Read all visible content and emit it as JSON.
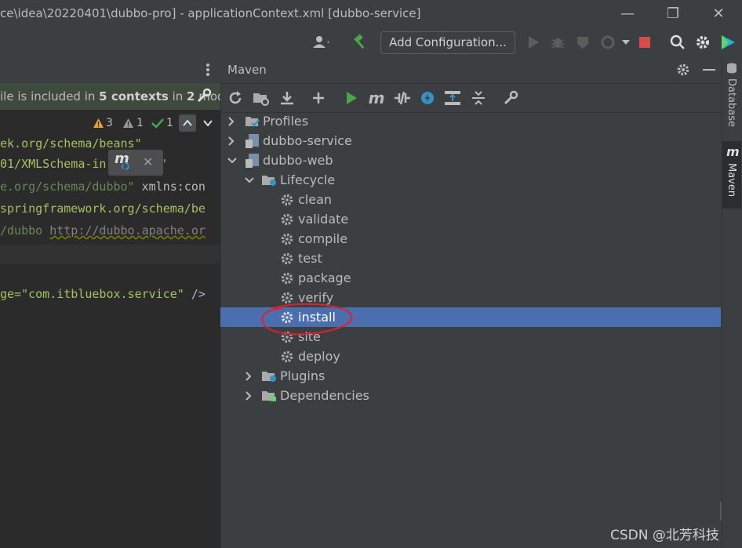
{
  "window": {
    "title": "ce\\idea\\20220401\\dubbo-pro] - applicationContext.xml [dubbo-service]"
  },
  "toolbar": {
    "add_configuration_label": "Add Configuration..."
  },
  "editor": {
    "context_banner": {
      "prefix": "ile is included in ",
      "contexts": "5 contexts",
      "middle": " in ",
      "modules_count": "2",
      "suffix": " module"
    },
    "inspections": {
      "warnings": "3",
      "weak_warnings": "1",
      "typos": "1"
    },
    "hint_popup_glyph": "m",
    "code_lines": [
      "ek.org/schema/beans\"",
      "01/XMLSchema-in",
      "\"",
      "e.org/schema/dubbo\"",
      "xmlns:con",
      "springframework.org/schema/be",
      "/dubbo ",
      "http://dubbo.apache.or",
      "ge=\"com.itbluebox.service\"",
      "/>"
    ]
  },
  "maven": {
    "title": "Maven",
    "tree": {
      "profiles": "Profiles",
      "dubbo_service": "dubbo-service",
      "dubbo_web": "dubbo-web",
      "lifecycle": "Lifecycle",
      "goals": [
        "clean",
        "validate",
        "compile",
        "test",
        "package",
        "verify",
        "install",
        "site",
        "deploy"
      ],
      "selected_goal": "install",
      "plugins": "Plugins",
      "dependencies": "Dependencies"
    }
  },
  "right_strip": {
    "database": "Database",
    "maven": "Maven",
    "maven_glyph": "m"
  },
  "watermark": "CSDN @北芳科技",
  "colors": {
    "selection": "#4b6eaf",
    "annotation_circle": "#e0202a",
    "run_green": "#4ea34e",
    "stop_red": "#d84b4b",
    "xml_string": "#6a8759"
  }
}
